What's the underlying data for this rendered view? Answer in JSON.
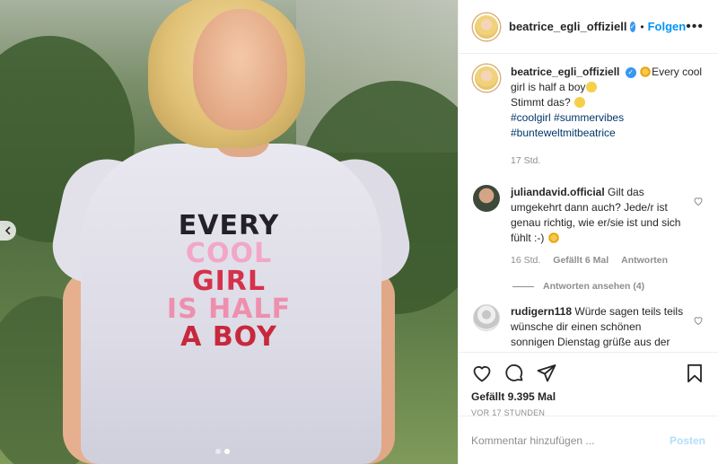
{
  "photo": {
    "shirt_lines": [
      "EVERY",
      "COOL",
      "GIRL",
      "IS HALF",
      "A BOY"
    ],
    "carousel": {
      "total": 2,
      "active": 2
    },
    "prev_icon": "chevron-left-icon"
  },
  "header": {
    "username": "beatrice_egli_offiziell",
    "separator": "•",
    "follow_label": "Folgen",
    "more_icon": "ellipsis-icon",
    "verified_icon": "verified-badge-icon"
  },
  "caption": {
    "username": "beatrice_egli_offiziell",
    "text_1": "Every cool girl is half a boy",
    "text_2": "Stimmt das?",
    "tags": [
      "#coolgirl",
      "#summervibes",
      "#bunteweltmitbeatrice"
    ],
    "time": "17 Std."
  },
  "comments": [
    {
      "username": "juliandavid.official",
      "text": "Gilt das umgekehrt dann auch? Jede/r ist genau richtig, wie er/sie ist und sich fühlt :-)",
      "time": "16 Std.",
      "likes": "Gefällt 6 Mal",
      "reply": "Antworten",
      "view_replies": "Antworten ansehen (4)"
    },
    {
      "username": "rudigern118",
      "text": "Würde sagen teils teils wünsche dir einen schönen sonnigen Dienstag grüße aus der"
    }
  ],
  "actions": {
    "like_icon": "heart-icon",
    "comment_icon": "comment-icon",
    "share_icon": "share-icon",
    "save_icon": "bookmark-icon",
    "likes_text": "Gefällt 9.395 Mal",
    "timestamp": "VOR 17 STUNDEN"
  },
  "composer": {
    "placeholder": "Kommentar hinzufügen ...",
    "post_label": "Posten"
  },
  "colors": {
    "link": "#00376b",
    "accent": "#0095f6",
    "muted": "#8e8e8e",
    "post_disabled": "#b2dffc"
  }
}
